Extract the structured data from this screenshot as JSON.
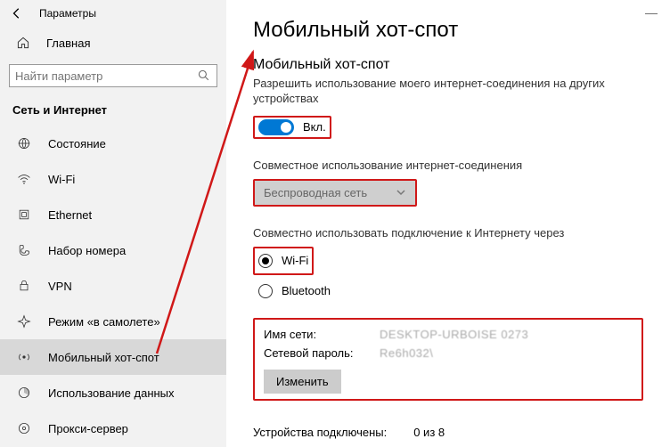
{
  "titlebar": {
    "title": "Параметры"
  },
  "home": {
    "label": "Главная"
  },
  "search": {
    "placeholder": "Найти параметр"
  },
  "sidebar": {
    "section": "Сеть и Интернет",
    "items": [
      {
        "label": "Состояние"
      },
      {
        "label": "Wi-Fi"
      },
      {
        "label": "Ethernet"
      },
      {
        "label": "Набор номера"
      },
      {
        "label": "VPN"
      },
      {
        "label": "Режим «в самолете»"
      },
      {
        "label": "Мобильный хот-спот"
      },
      {
        "label": "Использование данных"
      },
      {
        "label": "Прокси-сервер"
      }
    ]
  },
  "page": {
    "title": "Мобильный хот-спот",
    "hotspot": {
      "heading": "Мобильный хот-спот",
      "description": "Разрешить использование моего интернет-соединения на других устройствах",
      "toggle_label": "Вкл."
    },
    "share_label": "Совместное использование интернет-соединения",
    "share_dropdown": "Беспроводная сеть",
    "share_over_label": "Совместно использовать подключение к Интернету через",
    "radio_wifi": "Wi-Fi",
    "radio_bt": "Bluetooth",
    "net": {
      "name_label": "Имя сети:",
      "name_value": "DESKTOP-URBOISE 0273",
      "pwd_label": "Сетевой пароль:",
      "pwd_value": "Re6h032\\",
      "edit": "Изменить"
    },
    "devices": {
      "label": "Устройства подключены:",
      "value": "0 из 8"
    }
  }
}
